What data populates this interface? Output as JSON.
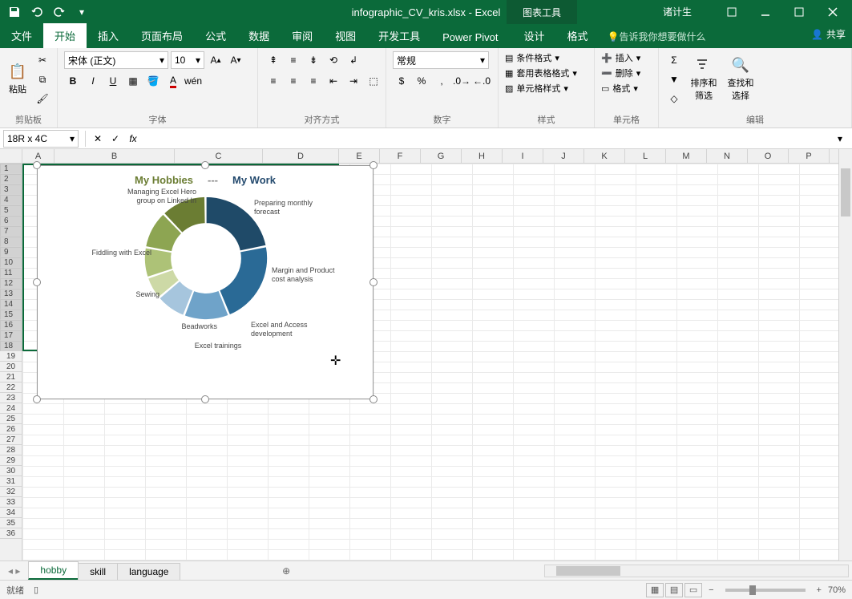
{
  "titlebar": {
    "filename": "infographic_CV_kris.xlsx - Excel",
    "chart_tools": "图表工具",
    "username": "诸计生"
  },
  "tabs": {
    "file": "文件",
    "home": "开始",
    "insert": "插入",
    "layout": "页面布局",
    "formulas": "公式",
    "data": "数据",
    "review": "审阅",
    "view": "视图",
    "developer": "开发工具",
    "powerpivot": "Power Pivot",
    "design": "设计",
    "format": "格式",
    "tellme": "告诉我你想要做什么",
    "share": "共享"
  },
  "ribbon": {
    "clipboard": {
      "paste": "粘贴",
      "label": "剪贴板"
    },
    "font": {
      "name": "宋体 (正文)",
      "size": "10",
      "label": "字体"
    },
    "alignment": {
      "label": "对齐方式"
    },
    "number": {
      "format": "常规",
      "label": "数字"
    },
    "styles": {
      "cond": "条件格式",
      "table": "套用表格格式",
      "cell": "单元格样式",
      "label": "样式"
    },
    "cells": {
      "insert": "插入",
      "delete": "删除",
      "format_c": "格式",
      "label": "单元格"
    },
    "editing": {
      "sort": "排序和筛选",
      "find": "查找和选择",
      "label": "编辑"
    }
  },
  "fnbar": {
    "namebox": "18R x 4C"
  },
  "cols": [
    "A",
    "B",
    "C",
    "D",
    "E",
    "F",
    "G",
    "H",
    "I",
    "J",
    "K",
    "L",
    "M",
    "N",
    "O",
    "P"
  ],
  "chart_data": {
    "type": "doughnut",
    "title_left": "My Hobbies",
    "title_right": "My Work",
    "series": [
      {
        "name": "work",
        "color_legend": "#244a6e",
        "slices": [
          {
            "label": "Preparing monthly forecast",
            "value": 22,
            "color": "#1f4a68"
          },
          {
            "label": "Margin and Product cost analysis",
            "value": 22,
            "color": "#2a6a96"
          },
          {
            "label": "Excel and Access development",
            "value": 12,
            "color": "#6fa3c9"
          },
          {
            "label": "Excel trainings",
            "value": 8,
            "color": "#a6c5dd"
          }
        ]
      },
      {
        "name": "hobbies",
        "color_legend": "#6b7d33",
        "slices": [
          {
            "label": "Beadworks",
            "value": 6,
            "color": "#cdd9a6"
          },
          {
            "label": "Sewing",
            "value": 8,
            "color": "#adc277"
          },
          {
            "label": "Fiddling with Excel",
            "value": 10,
            "color": "#8da552"
          },
          {
            "label": "Managing Excel Hero group on Linked In",
            "value": 12,
            "color": "#6b7d33"
          }
        ]
      }
    ]
  },
  "sheets": {
    "active": "hobby",
    "tabs": [
      "hobby",
      "skill",
      "language"
    ]
  },
  "status": {
    "ready": "就绪",
    "zoom": "70%"
  }
}
